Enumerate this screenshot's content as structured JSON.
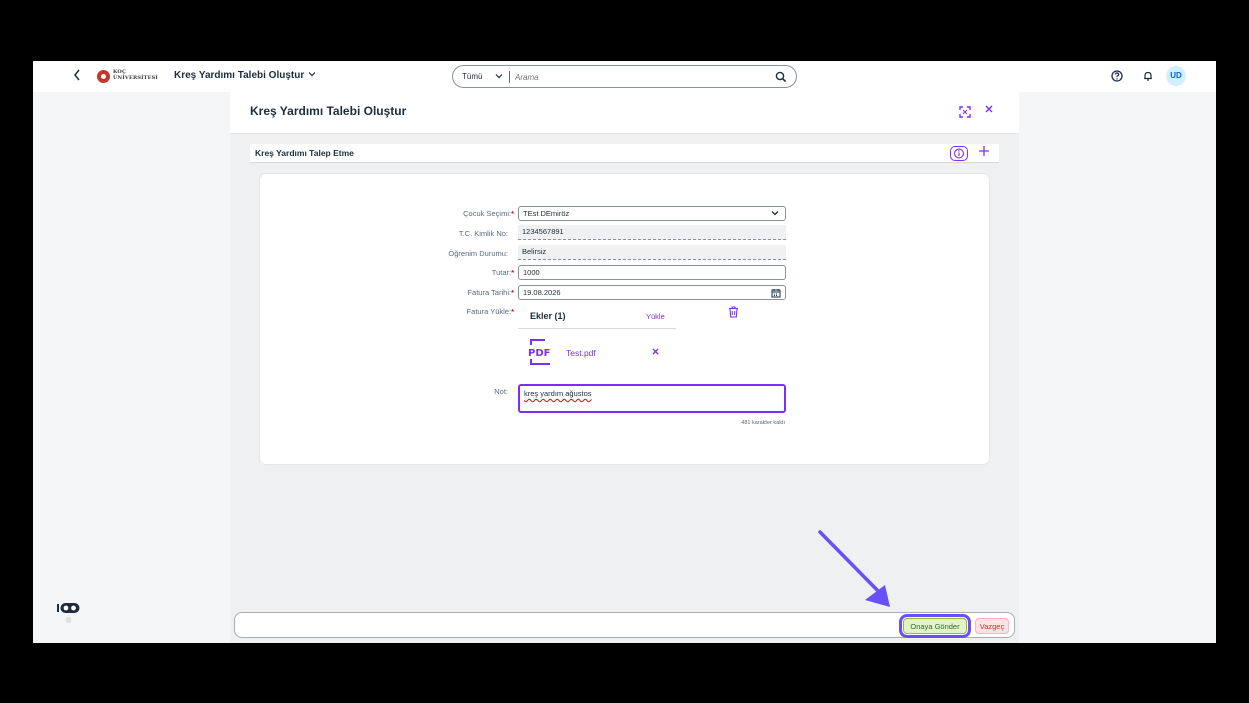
{
  "shell": {
    "back_icon": "chevron-left-icon",
    "logo_top": "KOÇ",
    "logo_bottom": "ÜNİVERSİTESİ",
    "app_title": "Kreş Yardımı Talebi Oluştur",
    "search": {
      "scope": "Tümü",
      "placeholder": "Arama"
    },
    "avatar_initials": "UD"
  },
  "dialog": {
    "title": "Kreş Yardımı Talebi Oluştur",
    "section_title": "Kreş Yardımı Talep Etme",
    "form": {
      "child_label": "Çocuk Seçimi:",
      "child_value": "TEst DEmiröz",
      "tc_label": "T.C. Kimlik No:",
      "tc_value": "1234567891",
      "edu_label": "Öğrenim Durumu:",
      "edu_value": "Belirsiz",
      "amount_label": "Tutar:",
      "amount_value": "1000",
      "date_label": "Fatura Tarihi:",
      "date_value": "19.08.2026",
      "upload_label": "Fatura Yükle:",
      "attachments_title": "Ekler (1)",
      "upload_link": "Yükle",
      "file_name": "Test.pdf",
      "note_label": "Not:",
      "note_value": "kreş yardım ağustos",
      "char_count": "481 karakter kaldı"
    }
  },
  "footer": {
    "submit_label": "Onaya Gönder",
    "cancel_label": "Vazgeç"
  },
  "colors": {
    "accent": "#7d2ef5",
    "annotation_arrow": "#6750f5",
    "submit_bg": "#e5f2c8",
    "cancel_bg": "#ffe2e6"
  }
}
